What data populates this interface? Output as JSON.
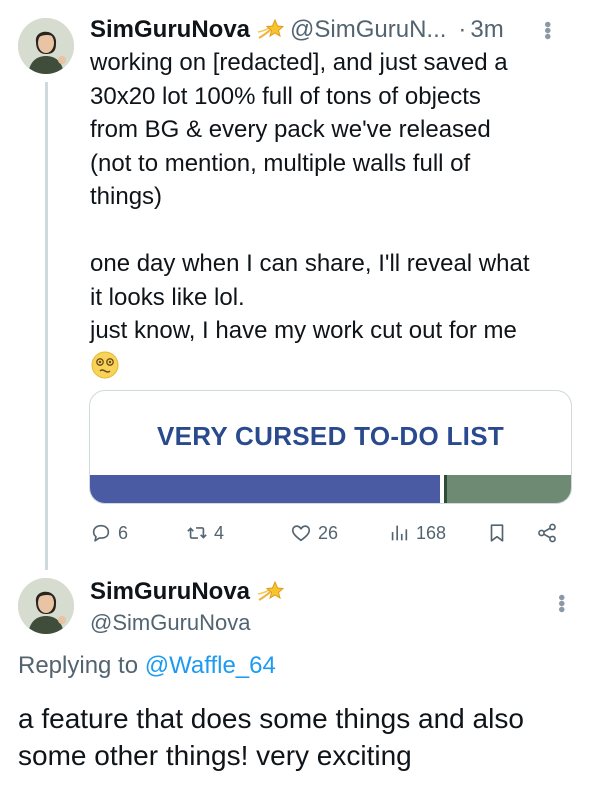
{
  "tweet1": {
    "display_name": "SimGuruNova",
    "handle": "@SimGuruN...",
    "separator": "·",
    "time": "3m",
    "body_lines": [
      "working on [redacted], and just saved a",
      "30x20 lot 100% full of tons of objects",
      "from BG & every pack we've released",
      "(not to mention, multiple walls full of",
      "things)"
    ],
    "body_lines_2": [
      "one day when I can share, I'll reveal what",
      "it looks like lol.",
      "just know, I have my work cut out for me"
    ],
    "emoji": "dizzy-face-emoji",
    "card": {
      "title": "VERY CURSED TO-DO LIST"
    },
    "actions": {
      "replies": "6",
      "retweets": "4",
      "likes": "26",
      "views": "168"
    }
  },
  "tweet2": {
    "display_name": "SimGuruNova",
    "handle": "@SimGuruNova",
    "reply_prefix": "Replying to",
    "reply_mention": "@Waffle_64",
    "body": "a feature that does some things and also some other things! very exciting"
  },
  "icons": {
    "badge": "sparkle-star-badge-icon",
    "reply": "reply-bubble-icon",
    "retweet": "retweet-icon",
    "like": "heart-icon",
    "views": "views-bars-icon",
    "bookmark": "bookmark-icon",
    "share": "share-icon",
    "more": "more-dots-icon"
  },
  "colors": {
    "accent": "#1d9bf0",
    "secondary_text": "#536471",
    "card_title": "#2a4a8e",
    "card_band": "#4a5ba3"
  }
}
